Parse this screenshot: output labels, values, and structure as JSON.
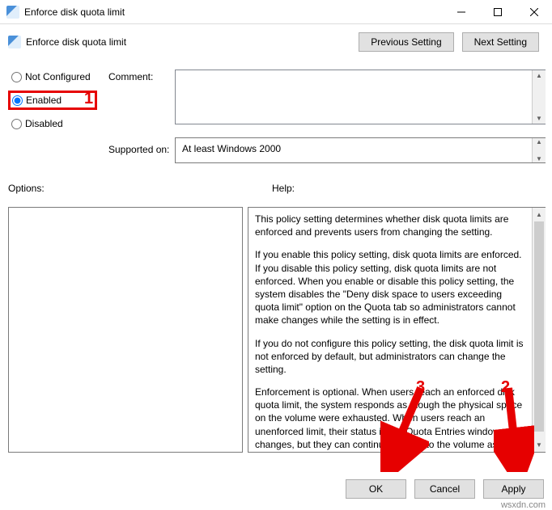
{
  "window": {
    "title": "Enforce disk quota limit"
  },
  "header": {
    "title": "Enforce disk quota limit",
    "prev": "Previous Setting",
    "next": "Next Setting"
  },
  "radios": {
    "not_configured": "Not Configured",
    "enabled": "Enabled",
    "disabled": "Disabled"
  },
  "labels": {
    "comment": "Comment:",
    "supported": "Supported on:",
    "options": "Options:",
    "help": "Help:"
  },
  "supported_value": "At least Windows 2000",
  "help_text": {
    "p1": "This policy setting determines whether disk quota limits are enforced and prevents users from changing the setting.",
    "p2": "If you enable this policy setting, disk quota limits are enforced. If you disable this policy setting, disk quota limits are not enforced. When you enable or disable this policy setting, the system disables the \"Deny disk space to users exceeding quota limit\" option on the Quota tab so administrators cannot make changes while the setting is in effect.",
    "p3": "If you do not configure this policy setting, the disk quota limit is not enforced by default, but administrators can change the setting.",
    "p4": "Enforcement is optional. When users reach an enforced disk quota limit, the system responds as though the physical space on the volume were exhausted. When users reach an unenforced limit, their status in the Quota Entries window changes, but they can continue to write to the volume as long as physical space is available."
  },
  "buttons": {
    "ok": "OK",
    "cancel": "Cancel",
    "apply": "Apply"
  },
  "annotations": {
    "n1": "1",
    "n2": "2",
    "n3": "3"
  },
  "watermark": "wsxdn.com"
}
